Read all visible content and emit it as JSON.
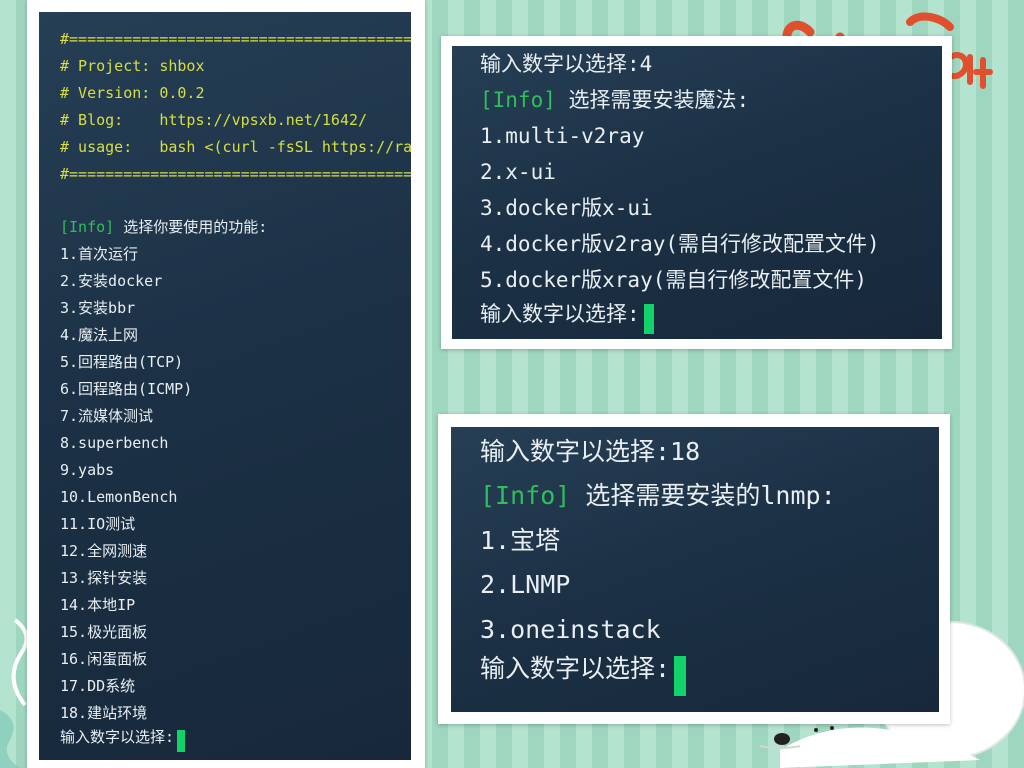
{
  "colors": {
    "background": "#a8dcc6",
    "terminal_bg": "#1c3146",
    "comment_text": "#d7df3e",
    "info_tag": "#2fbf5a",
    "plain_text": "#e8eef2",
    "cursor": "#12d36a",
    "decor_red": "#e0502e"
  },
  "icons": {
    "cursor": "block-cursor-icon",
    "decoration_bear": "polar-bear-illustration",
    "decoration_title": "red-script-title"
  },
  "left_terminal": {
    "header": [
      "#======================================",
      "# Project: shbox",
      "# Version: 0.0.2",
      "# Blog:    https://vpsxb.net/1642/",
      "# usage:   bash <(curl -fsSL https://raw.",
      "#======================================"
    ],
    "info_tag": "[Info]",
    "info_text": " 选择你要使用的功能:",
    "menu": [
      "1.首次运行",
      "2.安装docker",
      "3.安装bbr",
      "4.魔法上网",
      "5.回程路由(TCP)",
      "6.回程路由(ICMP)",
      "7.流媒体测试",
      "8.superbench",
      "9.yabs",
      "10.LemonBench",
      "11.IO测试",
      "12.全网测速",
      "13.探针安装",
      "14.本地IP",
      "15.极光面板",
      "16.闲蛋面板",
      "17.DD系统",
      "18.建站环境"
    ],
    "prompt": "输入数字以选择:"
  },
  "top_right_terminal": {
    "prev_input": "输入数字以选择:4",
    "info_tag": "[Info]",
    "info_text": " 选择需要安装魔法:",
    "menu": [
      "1.multi-v2ray",
      "2.x-ui",
      "3.docker版x-ui",
      "4.docker版v2ray(需自行修改配置文件)",
      "5.docker版xray(需自行修改配置文件)"
    ],
    "prompt": "输入数字以选择:"
  },
  "bottom_right_terminal": {
    "prev_input": "输入数字以选择:18",
    "info_tag": "[Info]",
    "info_text": " 选择需要安装的lnmp:",
    "menu": [
      "1.宝塔",
      "2.LNMP",
      "3.oneinstack"
    ],
    "prompt": "输入数字以选择:"
  }
}
